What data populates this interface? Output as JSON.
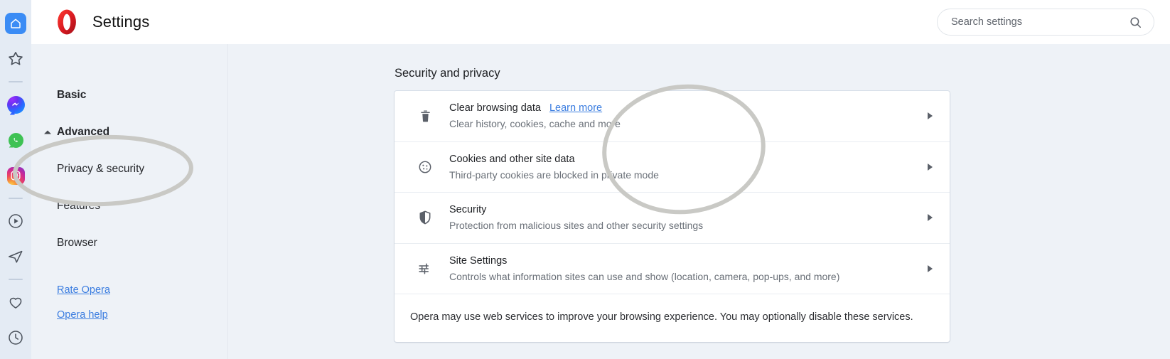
{
  "rail": {
    "items": [
      {
        "name": "home-icon",
        "label": "Home"
      },
      {
        "name": "star-icon",
        "label": "Speed Dial"
      },
      {
        "name": "divider-1",
        "label": ""
      },
      {
        "name": "messenger-icon",
        "label": "Messenger"
      },
      {
        "name": "whatsapp-icon",
        "label": "WhatsApp"
      },
      {
        "name": "instagram-icon",
        "label": "Instagram"
      },
      {
        "name": "divider-2",
        "label": ""
      },
      {
        "name": "player-icon",
        "label": "Player"
      },
      {
        "name": "send-icon",
        "label": "Send"
      },
      {
        "name": "divider-3",
        "label": ""
      },
      {
        "name": "heart-icon",
        "label": "Favorites"
      },
      {
        "name": "clock-icon",
        "label": "History"
      }
    ]
  },
  "header": {
    "title": "Settings",
    "logo_name": "opera-logo",
    "logo_color": "#d0232b"
  },
  "search": {
    "placeholder": "Search settings",
    "value": "",
    "icon_name": "search-icon"
  },
  "sidebar": {
    "items": [
      {
        "label": "Basic",
        "bold": true,
        "caret": false
      },
      {
        "label": "Advanced",
        "bold": true,
        "caret": true
      },
      {
        "label": "Privacy & security",
        "bold": false,
        "caret": false
      },
      {
        "label": "Features",
        "bold": false,
        "caret": false
      },
      {
        "label": "Browser",
        "bold": false,
        "caret": false
      }
    ],
    "links": [
      {
        "label": "Rate Opera"
      },
      {
        "label": "Opera help"
      }
    ],
    "link_color": "#3b7de0"
  },
  "main": {
    "section_title": "Security and privacy",
    "rows": [
      {
        "icon": "trash-icon",
        "title": "Clear browsing data",
        "link": "Learn more",
        "subtitle": "Clear history, cookies, cache and more",
        "chevron": "chevron-right-icon"
      },
      {
        "icon": "cookie-icon",
        "title": "Cookies and other site data",
        "link": "",
        "subtitle": "Third-party cookies are blocked in private mode",
        "chevron": "chevron-right-icon"
      },
      {
        "icon": "shield-icon",
        "title": "Security",
        "link": "",
        "subtitle": "Protection from malicious sites and other security settings",
        "chevron": "chevron-right-icon"
      },
      {
        "icon": "sliders-icon",
        "title": "Site Settings",
        "link": "",
        "subtitle": "Controls what information sites can use and show (location, camera, pop-ups, and more)",
        "chevron": "chevron-right-icon"
      }
    ],
    "note": "Opera may use web services to improve your browsing experience. You may optionally disable these services."
  },
  "annotations": {
    "color": "#c9c9c5",
    "sidebar_ellipse": "highlight-privacy-and-security",
    "card_ellipse": "highlight-clear-browsing-data"
  }
}
